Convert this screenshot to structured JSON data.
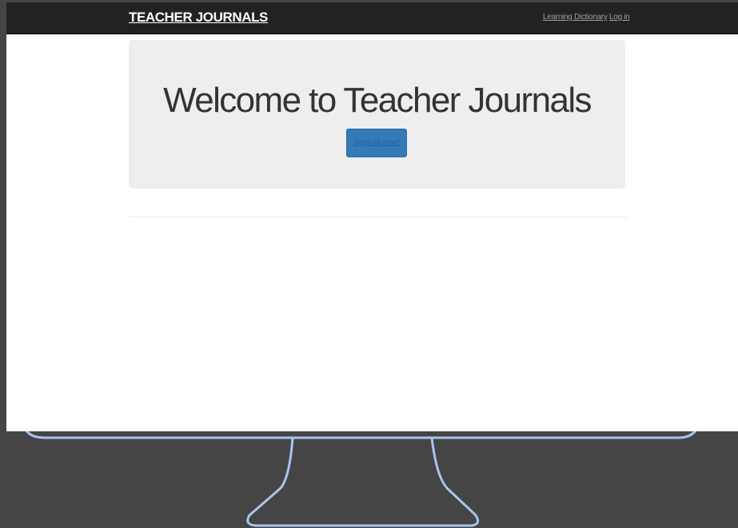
{
  "navbar": {
    "brand": "TEACHER JOURNALS",
    "links": [
      {
        "label": "Learning Dictionary"
      },
      {
        "label": "Log in"
      }
    ]
  },
  "jumbotron": {
    "title": "Welcome to Teacher Journals",
    "signup_label": "Sign up now!"
  },
  "colors": {
    "navbar_bg": "#222222",
    "jumbotron_bg": "#eeeeee",
    "primary_button": "#337ab7",
    "monitor_outline": "#a8c4f0",
    "background": "#454545"
  }
}
